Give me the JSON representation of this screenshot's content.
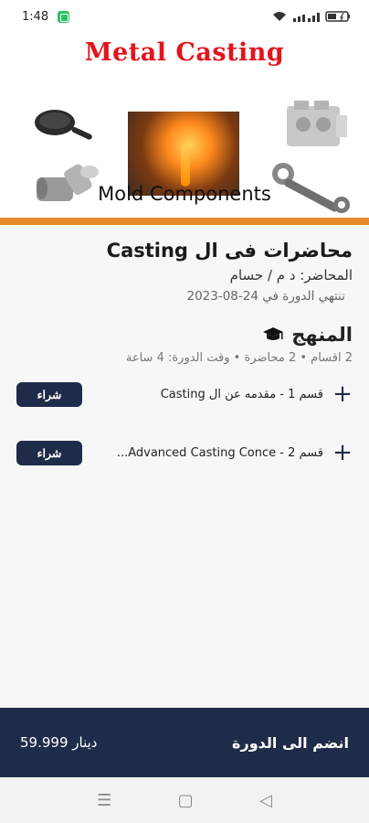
{
  "status_bar": {
    "time": "1:48",
    "battery_icon": "battery-icon",
    "wifi_icon": "wifi-icon",
    "signal_icon": "signal-icon"
  },
  "banner": {
    "title": "Metal Casting",
    "subtitle": "Mold Components"
  },
  "course": {
    "title": "محاضرات فى ال Casting",
    "instructor": "المحاضر: د م / حسام",
    "end_date": "تنتهي الدورة في 24-08-2023"
  },
  "curriculum": {
    "heading": "المنهج",
    "icon": "graduation-cap-icon",
    "meta": "2 اقسام  •  2 محاضرة  •  وقت الدورة: 4 ساعة",
    "sections": [
      {
        "label": "قسم 1 - مقدمه عن ال Casting",
        "buy_label": "شراء"
      },
      {
        "label": "قسم 2 - Advanced Casting Conce...",
        "buy_label": "شراء"
      }
    ]
  },
  "footer": {
    "join_label": "انضم الى الدورة",
    "price": "59.999 دينار"
  },
  "nav_bar": {
    "menu": "☰",
    "home": "▢",
    "back": "◁"
  },
  "colors": {
    "primary": "#1f2c49",
    "accent": "#e58a2c",
    "title_red": "#e3141e"
  }
}
